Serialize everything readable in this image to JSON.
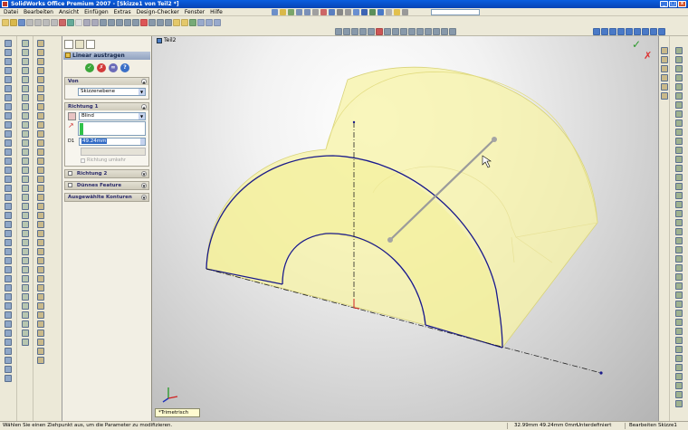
{
  "window": {
    "title": "SolidWorks Office Premium 2007 - [Skizze1 von Teil2 *]",
    "buttons": [
      "_",
      "□",
      "x"
    ]
  },
  "menu": [
    "Datei",
    "Bearbeiten",
    "Ansicht",
    "Einfügen",
    "Extras",
    "Design-Checker",
    "Fenster",
    "Hilfe"
  ],
  "document_tab": "Teil2",
  "property_manager": {
    "title": "Linear austragen",
    "buttons": {
      "ok": "✓",
      "cancel": "✗",
      "preview": "∞",
      "help": "?"
    },
    "sections": {
      "von": {
        "label": "Von",
        "value": "Skizzenebene"
      },
      "richtung1": {
        "label": "Richtung 1",
        "end_condition": "Blind",
        "depth": "49.24mm",
        "checkbox_label": "Richtung umkehr"
      },
      "richtung2": {
        "label": "Richtung 2"
      },
      "duennes": {
        "label": "Dünnes Feature"
      },
      "konturen": {
        "label": "Ausgewählte Konturen"
      }
    }
  },
  "graphics": {
    "view_label": "*Trimetrisch",
    "accent_colors": {
      "extrude_fill": "#f7f3a6",
      "sketch_edge": "#1a1a8a",
      "axis": "#222222"
    }
  },
  "status": {
    "hint": "Wählen Sie einen Ziehpunkt aus, um die Parameter zu modifizieren.",
    "x": "32.99mm",
    "y": "49.24mm",
    "z": "0mm",
    "definition": "Unterdefiniert",
    "editing": "Bearbeiten Skizze1"
  }
}
